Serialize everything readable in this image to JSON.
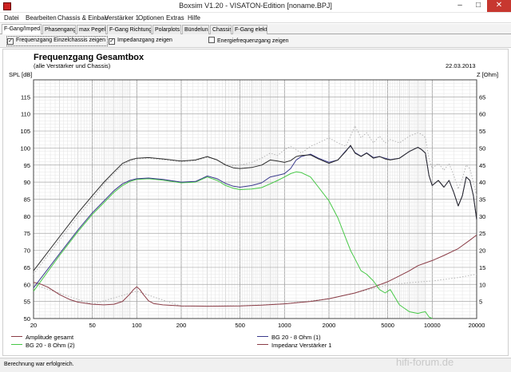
{
  "window": {
    "title": "Boxsim V1.20 - VISATON-Edition [noname.BPJ]",
    "min_glyph": "–",
    "max_glyph": "□",
    "close_glyph": "✕"
  },
  "menu": [
    "Datei",
    "Bearbeiten",
    "Chassis & Einbau",
    "Verstärker 1",
    "Optionen",
    "Extras",
    "Hilfe"
  ],
  "tabs": [
    {
      "label": "F-Gang/Imped.",
      "active": true
    },
    {
      "label": "Phasengang",
      "active": false
    },
    {
      "label": "max Pegel",
      "active": false
    },
    {
      "label": "F-Gang Richtungen",
      "active": false
    },
    {
      "label": "Polarplots",
      "active": false
    },
    {
      "label": "Bündelung",
      "active": false
    },
    {
      "label": "Chassis",
      "active": false
    },
    {
      "label": "F-Gang elektr.",
      "active": false
    }
  ],
  "options": [
    {
      "label": "Frequenzgang Einzelchassis zeigen",
      "checked": true
    },
    {
      "label": "Impedanzgang zeigen",
      "checked": true
    },
    {
      "label": "Energiefrequenzgang zeigen",
      "checked": false
    }
  ],
  "chart_data": {
    "type": "line",
    "title": "Frequenzgang Gesamtbox",
    "subtitle": "(alle Verstärker und Chassis)",
    "date": "22.03.2013",
    "ylabel_left": "SPL [dB]",
    "ylabel_right": "Z [Ohm]",
    "xscale": "log",
    "xlim": [
      20,
      20000
    ],
    "ylim_left": [
      50,
      120
    ],
    "ylim_right": [
      0,
      70
    ],
    "grid": true,
    "xticks": [
      "20",
      "50",
      "100",
      "200",
      "500",
      "1000",
      "2000",
      "5000",
      "10000",
      "20000"
    ],
    "yticks_left": [
      "50",
      "55",
      "60",
      "65",
      "70",
      "75",
      "80",
      "85",
      "90",
      "95",
      "100",
      "105",
      "110",
      "115"
    ],
    "yticks_right": [
      "5",
      "10",
      "15",
      "20",
      "25",
      "30",
      "35",
      "40",
      "45",
      "50",
      "55",
      "60",
      "65"
    ],
    "series": [
      {
        "name": "Amplitude gesamt",
        "color": "#2b2b2b",
        "axis": "left",
        "x": [
          20,
          30,
          40,
          50,
          60,
          70,
          80,
          90,
          100,
          120,
          150,
          200,
          250,
          300,
          350,
          400,
          450,
          500,
          600,
          700,
          800,
          900,
          1000,
          1100,
          1200,
          1300,
          1500,
          1700,
          2000,
          2300,
          2600,
          2800,
          3000,
          3300,
          3600,
          4000,
          4400,
          4800,
          5200,
          6000,
          7000,
          8000,
          8500,
          9000,
          9500,
          10000,
          11000,
          12000,
          13000,
          14000,
          15000,
          16000,
          17000,
          18000,
          19000,
          20000
        ],
        "y": [
          64,
          74,
          81,
          86,
          90,
          93,
          95.5,
          96.5,
          97,
          97.2,
          96.8,
          96.2,
          96.5,
          97.5,
          96.5,
          95,
          94.2,
          94,
          94.3,
          95,
          96.5,
          96.2,
          95.8,
          96.3,
          97.5,
          97.8,
          98,
          96.8,
          95.5,
          96.5,
          99,
          100.8,
          98.5,
          97.5,
          98.5,
          97,
          97.5,
          96.8,
          96.5,
          97,
          99,
          100.2,
          99.5,
          98.5,
          92,
          89,
          90.5,
          88.5,
          90.5,
          87,
          83,
          86,
          91.5,
          90.5,
          86,
          79
        ]
      },
      {
        "name": "BG 20 - 8 Ohm (1)",
        "color": "#3a3a8c",
        "axis": "left",
        "x": [
          20,
          30,
          40,
          50,
          60,
          70,
          80,
          90,
          100,
          120,
          150,
          200,
          250,
          300,
          350,
          400,
          450,
          500,
          600,
          700,
          800,
          900,
          1000,
          1100,
          1200,
          1300,
          1500,
          1700,
          2000,
          2300,
          2600,
          2800,
          3000,
          3300,
          3600,
          4000,
          4400,
          4800,
          5200,
          6000,
          7000,
          8000,
          8500,
          9000,
          9500,
          10000,
          11000,
          12000,
          13000,
          14000,
          15000,
          16000,
          17000,
          18000,
          19000,
          20000
        ],
        "y": [
          59,
          69,
          76,
          81,
          84.5,
          87.5,
          89.5,
          90.5,
          91,
          91.2,
          90.8,
          90,
          90.2,
          91.8,
          91,
          89.6,
          88.8,
          88.5,
          89,
          89.8,
          91.5,
          92,
          92.5,
          94,
          96.5,
          97.5,
          98.2,
          97,
          95.8,
          96.5,
          99.2,
          100.6,
          98.7,
          97.6,
          98.6,
          97.2,
          97.5,
          97,
          96.6,
          97,
          99,
          100.2,
          99.5,
          98.5,
          92,
          89,
          90.5,
          88.5,
          90.5,
          87,
          83,
          86,
          91.5,
          90.5,
          86,
          79
        ]
      },
      {
        "name": "BG 20 - 8 Ohm (2)",
        "color": "#46c846",
        "axis": "left",
        "x": [
          20,
          30,
          40,
          50,
          60,
          70,
          80,
          90,
          100,
          120,
          150,
          200,
          250,
          300,
          350,
          400,
          450,
          500,
          600,
          700,
          800,
          900,
          1000,
          1100,
          1200,
          1300,
          1500,
          1700,
          2000,
          2300,
          2600,
          2800,
          3000,
          3300,
          3600,
          4000,
          4400,
          4800,
          5200,
          6000,
          7000,
          8000,
          8500,
          9000,
          9500,
          10000
        ],
        "y": [
          58,
          68.5,
          75.5,
          80.5,
          84,
          87,
          89,
          90.2,
          90.8,
          91,
          90.6,
          89.8,
          90,
          91.5,
          90.5,
          89,
          88.2,
          87.8,
          88,
          88.4,
          89.5,
          90.5,
          91.5,
          92.5,
          93,
          92.8,
          91.5,
          88.5,
          84.5,
          79.5,
          73.5,
          70,
          67.5,
          64,
          63,
          61,
          58.5,
          57.5,
          58.5,
          54,
          52,
          51.5,
          51.8,
          52,
          50.5,
          50
        ]
      },
      {
        "name": "Impedanz Verstärker 1",
        "color": "#8a3c46",
        "axis": "right",
        "x": [
          20,
          22,
          25,
          30,
          35,
          40,
          50,
          60,
          70,
          80,
          90,
          95,
          100,
          105,
          110,
          120,
          130,
          150,
          200,
          300,
          500,
          700,
          1000,
          1500,
          2000,
          3000,
          4000,
          5000,
          6000,
          7000,
          8000,
          9000,
          10000,
          12000,
          15000,
          18000,
          20000
        ],
        "y": [
          10.6,
          10.2,
          9.2,
          7,
          5.6,
          4.8,
          4.2,
          4,
          4.2,
          5,
          7.2,
          8.5,
          9.3,
          8.5,
          7.2,
          5.2,
          4.4,
          4,
          3.7,
          3.6,
          3.7,
          3.9,
          4.3,
          5,
          5.8,
          7.5,
          9.2,
          10.8,
          12.5,
          14,
          15.5,
          16.3,
          17,
          18.5,
          20.5,
          23,
          24.5
        ]
      },
      {
        "name": "Energiefrequenzgang",
        "color": "#b4b4b4",
        "dashed": true,
        "axis": "left",
        "x": [
          20,
          30,
          40,
          50,
          60,
          70,
          80,
          90,
          100,
          120,
          150,
          200,
          250,
          300,
          350,
          400,
          450,
          500,
          600,
          700,
          800,
          900,
          1000,
          1100,
          1200,
          1300,
          1500,
          1700,
          2000,
          2300,
          2600,
          2800,
          3000,
          3300,
          3600,
          4000,
          4400,
          4800,
          5200,
          6000,
          7000,
          8000,
          8500,
          9000,
          9500,
          10000,
          11000,
          12000,
          13000,
          14000,
          15000,
          16000,
          17000,
          18000,
          19000,
          20000
        ],
        "y": [
          63,
          73,
          80,
          85,
          89.5,
          92.5,
          95,
          96.2,
          96.8,
          97,
          96.6,
          96,
          96.3,
          97.3,
          96.5,
          95.2,
          94.8,
          95,
          95.8,
          97,
          98.5,
          97.8,
          99.5,
          100.5,
          99.5,
          98.5,
          100.5,
          101.5,
          103,
          101.5,
          100.5,
          103.5,
          106.5,
          103,
          104.5,
          101.5,
          103.5,
          101.5,
          102.5,
          101.5,
          103.5,
          104.5,
          104,
          103,
          97,
          94,
          95.5,
          93.5,
          95.5,
          92,
          88,
          91,
          95,
          94,
          90,
          86
        ]
      },
      {
        "name": "Energie Impedanz",
        "color": "#b4b4b4",
        "dashed": true,
        "axis": "right",
        "x": [
          20,
          50,
          100,
          200,
          500,
          1000,
          2000,
          3000,
          5000,
          7000,
          10000,
          15000,
          20000
        ],
        "y": [
          10,
          4.2,
          8,
          3.6,
          3.7,
          4.3,
          5.8,
          7.5,
          9.8,
          10.5,
          11,
          12,
          13
        ]
      }
    ]
  },
  "legend": [
    {
      "label": "Amplitude gesamt",
      "color": "#8a3c46"
    },
    {
      "label": "BG 20 - 8 Ohm      (2)",
      "color": "#46c846"
    },
    {
      "label": "BG 20 - 8 Ohm      (1)",
      "color": "#3a3a8c"
    },
    {
      "label": "Impedanz Verstärker 1",
      "color": "#8a3c46"
    }
  ],
  "status": "Berechnung war erfolgreich.",
  "watermark": "hifi-forum.de"
}
